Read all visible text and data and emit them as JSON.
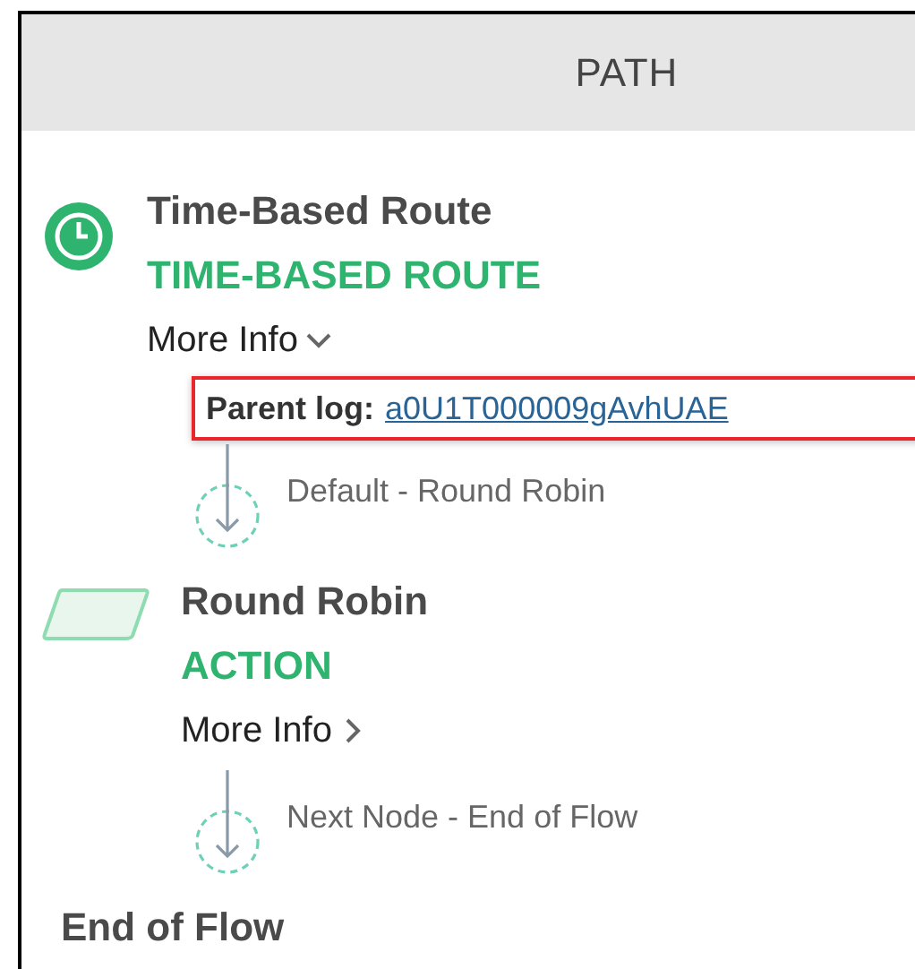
{
  "header": {
    "title": "PATH"
  },
  "nodes": [
    {
      "kind": "timer",
      "title": "Time-Based Route",
      "type": "TIME-BASED ROUTE",
      "more_info": {
        "label": "More Info",
        "expanded": true,
        "detail": {
          "label": "Parent log:",
          "link": "a0U1T000009gAvhUAE",
          "highlighted": true
        }
      },
      "connector": "Default - Round Robin"
    },
    {
      "kind": "action",
      "title": "Round Robin",
      "type": "ACTION",
      "more_info": {
        "label": "More Info",
        "expanded": false
      },
      "connector": "Next Node - End of Flow"
    },
    {
      "kind": "end",
      "title": "End of Flow"
    }
  ]
}
